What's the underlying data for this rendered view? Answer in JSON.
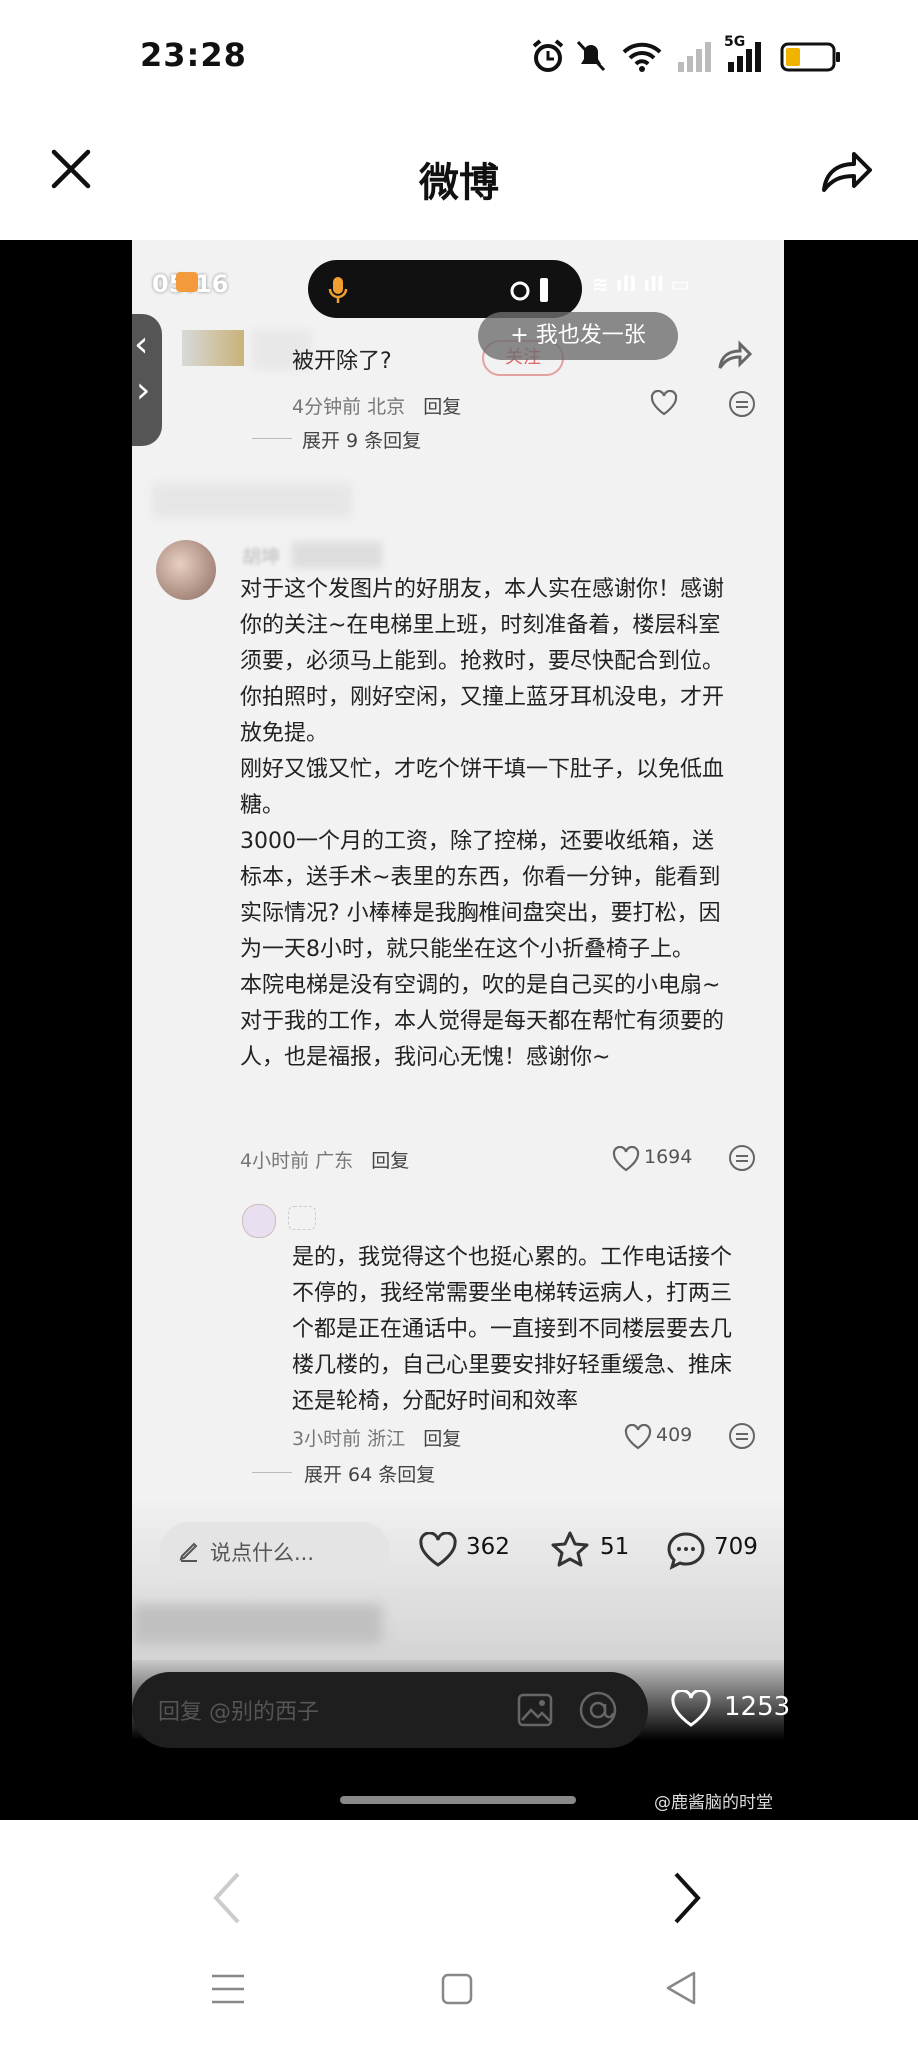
{
  "status_bar": {
    "time": "23:28",
    "network": "5G"
  },
  "header": {
    "title": "微博"
  },
  "inner": {
    "status_time": "05:16",
    "post_button": "+ 我也发一张",
    "follow_label": "关注",
    "comments": [
      {
        "text": "被开除了?",
        "time": "4分钟前",
        "location": "北京",
        "reply": "回复",
        "expand": "展开 9 条回复"
      },
      {
        "username": "胡坤",
        "lines": [
          "对于这个发图片的好朋友，本人实在感谢你！感谢",
          "你的关注~在电梯里上班，时刻准备着，楼层科室",
          "须要，必须马上能到。抢救时，要尽快配合到位。",
          "你拍照时，刚好空闲，又撞上蓝牙耳机没电，才开",
          "放免提。",
          "刚好又饿又忙，才吃个饼干填一下肚子，以免低血",
          "糖。",
          "3000一个月的工资，除了控梯，还要收纸箱，送",
          "标本，送手术~表里的东西，你看一分钟，能看到",
          "实际情况? 小棒棒是我胸椎间盘突出，要打松，因",
          "为一天8小时，就只能坐在这个小折叠椅子上。",
          "本院电梯是没有空调的，吹的是自己买的小电扇~",
          "对于我的工作，本人觉得是每天都在帮忙有须要的",
          "人，也是福报，我问心无愧！感谢你~"
        ],
        "time": "4小时前",
        "location": "广东",
        "reply": "回复",
        "likes": "1694"
      },
      {
        "lines": [
          "是的，我觉得这个也挺心累的。工作电话接个",
          "不停的，我经常需要坐电梯转运病人，打两三",
          "个都是正在通话中。一直接到不同楼层要去几",
          "楼几楼的，自己心里要安排好轻重缓急、推床",
          "还是轮椅，分配好时间和效率"
        ],
        "time": "3小时前",
        "location": "浙江",
        "reply": "回复",
        "likes": "409",
        "expand": "展开 64 条回复"
      }
    ],
    "bottom_bar": {
      "placeholder": "说点什么...",
      "likes": "362",
      "stars": "51",
      "comments": "709"
    },
    "outer_reply_placeholder": "回复 @别的西子",
    "outer_likes": "1253",
    "watermark": "@鹿酱脑的时堂"
  }
}
